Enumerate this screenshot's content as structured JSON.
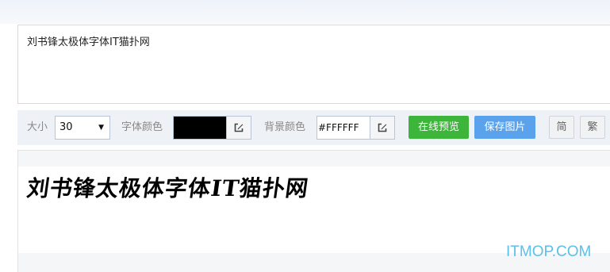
{
  "input": {
    "text": "刘书锋太极体字体IT猫扑网"
  },
  "toolbar": {
    "size_label": "大小",
    "size_value": "30",
    "font_color_label": "字体颜色",
    "font_color_value": "#000000",
    "bg_color_label": "背景颜色",
    "bg_color_value": "#FFFFFF",
    "preview_button": "在线预览",
    "save_button": "保存图片",
    "simplified_button": "简",
    "traditional_button": "繁"
  },
  "preview": {
    "text": "刘书锋太极体字体IT猫扑网"
  },
  "watermark": "ITMOP.COM",
  "colors": {
    "green": "#3db53a",
    "blue": "#5aa3ec",
    "watermark": "#5cc0e8"
  }
}
